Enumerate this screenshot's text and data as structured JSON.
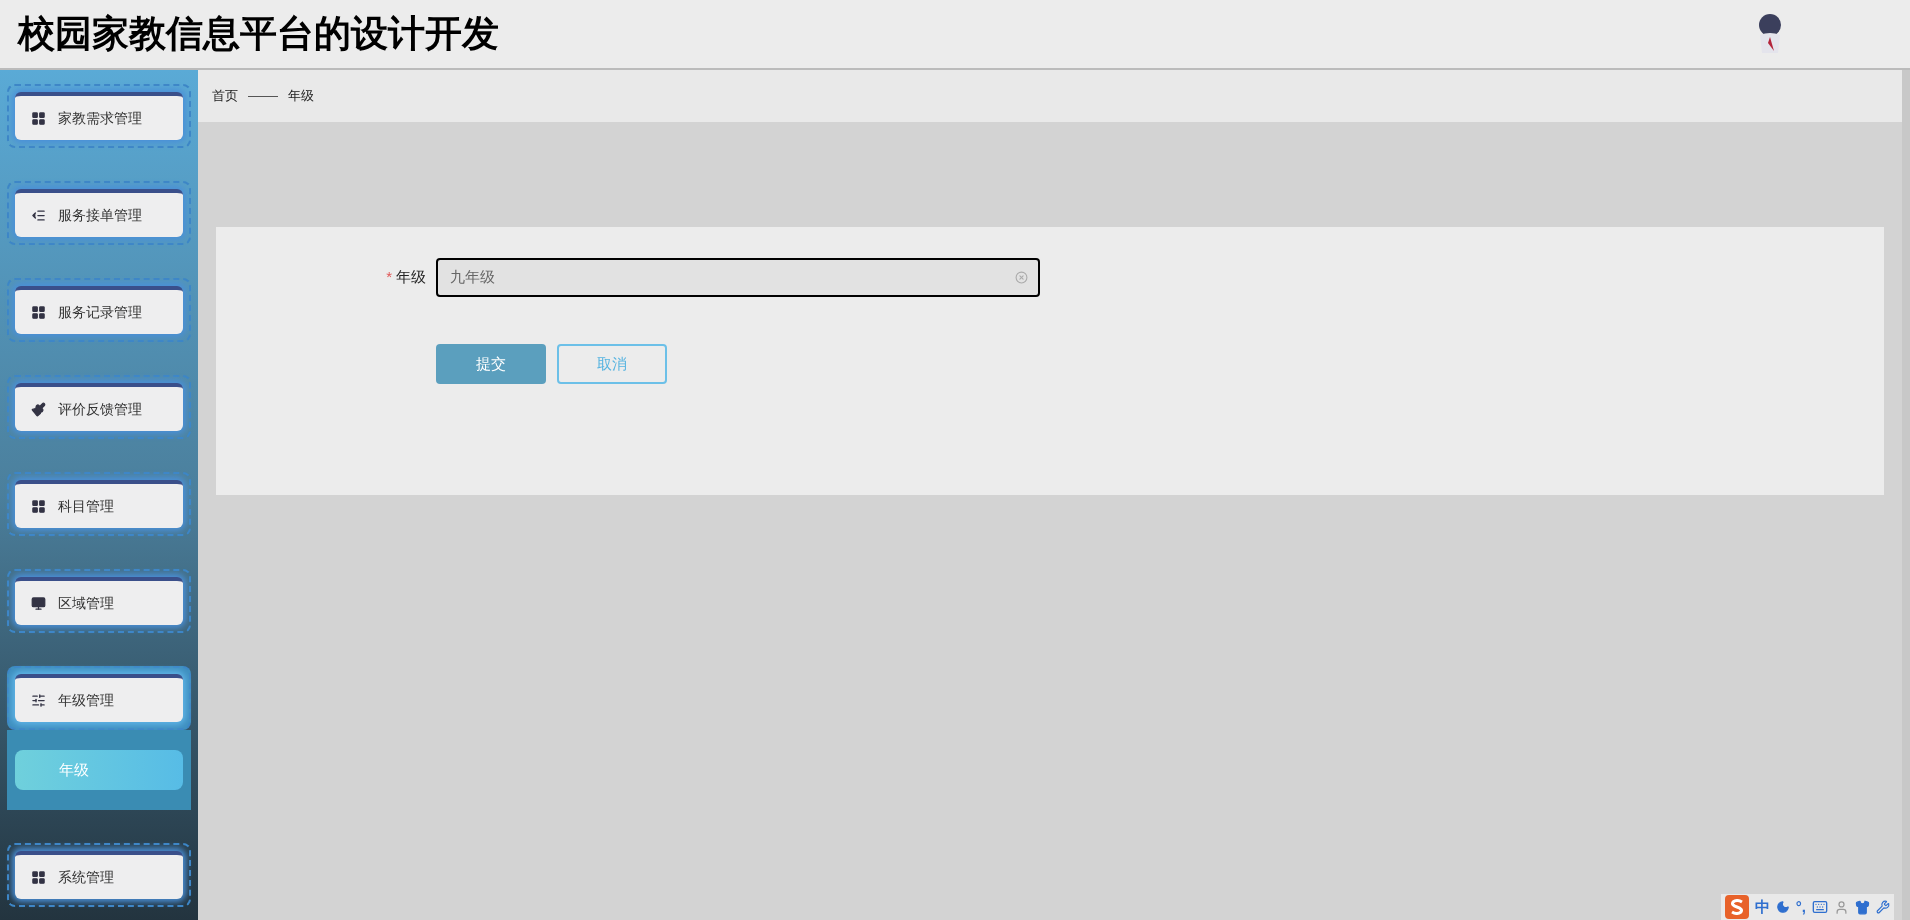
{
  "header": {
    "title": "校园家教信息平台的设计开发"
  },
  "sidebar": {
    "items": [
      {
        "label": "家教需求管理",
        "expanded": false
      },
      {
        "label": "服务接单管理",
        "expanded": false
      },
      {
        "label": "服务记录管理",
        "expanded": false
      },
      {
        "label": "评价反馈管理",
        "expanded": false
      },
      {
        "label": "科目管理",
        "expanded": false
      },
      {
        "label": "区域管理",
        "expanded": false
      },
      {
        "label": "年级管理",
        "expanded": true,
        "children": [
          {
            "label": "年级",
            "selected": true
          }
        ]
      },
      {
        "label": "系统管理",
        "expanded": false
      }
    ]
  },
  "breadcrumb": [
    "首页",
    "年级"
  ],
  "form": {
    "fields": [
      {
        "label": "年级",
        "required_mark": "*",
        "value": "九年级"
      }
    ],
    "buttons": [
      {
        "label": "提交",
        "kind": "primary"
      },
      {
        "label": "取消",
        "kind": "secondary"
      }
    ]
  },
  "ime_bar": {
    "language": "中",
    "punctuation": "°,"
  }
}
